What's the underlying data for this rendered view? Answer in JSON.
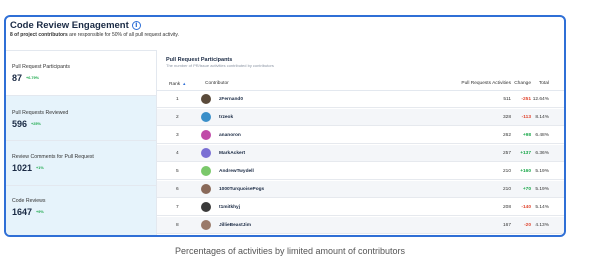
{
  "card": {
    "title": "Code Review Engagement",
    "subtitle_bold": "8 of project contributors",
    "subtitle_rest": " are responsible for 50% of all pull request activity."
  },
  "stats": [
    {
      "label": "Pull Request Participants",
      "value": "87",
      "delta": "+6.79%"
    },
    {
      "label": "Pull Requests Reviewed",
      "value": "596",
      "delta": "+25%"
    },
    {
      "label": "Review Comments for Pull Request",
      "value": "1021",
      "delta": "+1%"
    },
    {
      "label": "Code Reviews",
      "value": "1647",
      "delta": "+9%"
    }
  ],
  "panel": {
    "title": "Pull Request Participants",
    "subtitle": "The number of PR/issue activities contributed by contributors"
  },
  "columns": {
    "rank": "Rank",
    "contributor": "Contributor",
    "activities": "Pull Requests Activities",
    "change": "Change",
    "total": "Total"
  },
  "rows": [
    {
      "rank": "1",
      "name": "zFernand0",
      "activities": "511",
      "change": "-251",
      "dir": "neg",
      "total": "12.64%",
      "avatar": "#5a4a3a"
    },
    {
      "rank": "2",
      "name": "trzeok",
      "activities": "328",
      "change": "-113",
      "dir": "neg",
      "total": "8.14%",
      "avatar": "#3a8fc9"
    },
    {
      "rank": "3",
      "name": "ananoron",
      "activities": "262",
      "change": "+98",
      "dir": "pos",
      "total": "6.48%",
      "avatar": "#c04aa8"
    },
    {
      "rank": "4",
      "name": "MarkAckert",
      "activities": "257",
      "change": "+137",
      "dir": "pos",
      "total": "6.36%",
      "avatar": "#7a6fd4"
    },
    {
      "rank": "5",
      "name": "AndrewTwydell",
      "activities": "210",
      "change": "+160",
      "dir": "pos",
      "total": "5.19%",
      "avatar": "#7ac86a"
    },
    {
      "rank": "6",
      "name": "1000TurquoisePogs",
      "activities": "210",
      "change": "+70",
      "dir": "pos",
      "total": "5.19%",
      "avatar": "#8a6a5a"
    },
    {
      "rank": "7",
      "name": "t1mitkhyj",
      "activities": "208",
      "change": "-140",
      "dir": "neg",
      "total": "5.14%",
      "avatar": "#3a3a3a"
    },
    {
      "rank": "8",
      "name": "JillieBeastJim",
      "activities": "167",
      "change": "-20",
      "dir": "neg",
      "total": "4.13%",
      "avatar": "#9a7a6a"
    }
  ],
  "caption": "Percentages of activities by limited amount of contributors",
  "colors": {
    "accent": "#2f6fd6",
    "positive": "#1aa84a",
    "negative": "#e0442e",
    "stat_bg": "#e6f3fb"
  }
}
